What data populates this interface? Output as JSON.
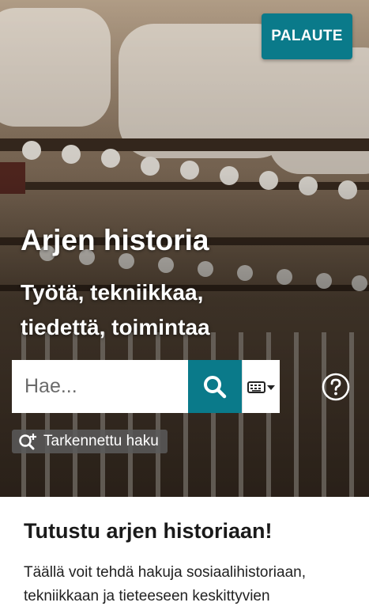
{
  "header": {
    "feedback_label": "PALAUTE"
  },
  "hero": {
    "title": "Arjen historia",
    "subtitle": "Työtä, tekniikkaa, tiedettä, toimintaa"
  },
  "search": {
    "placeholder": "Hae...",
    "search_icon": "search-icon",
    "keyboard_icon": "keyboard-icon",
    "help_icon": "help-icon",
    "advanced_label": "Tarkennettu haku",
    "advanced_icon": "zoom-plus-icon"
  },
  "intro": {
    "heading": "Tutustu arjen historiaan!",
    "text": "Täällä voit tehdä hakuja sosiaalihistoriaan, tekniikkaan ja tieteeseen keskittyvien"
  },
  "colors": {
    "accent": "#0a7a8a"
  }
}
